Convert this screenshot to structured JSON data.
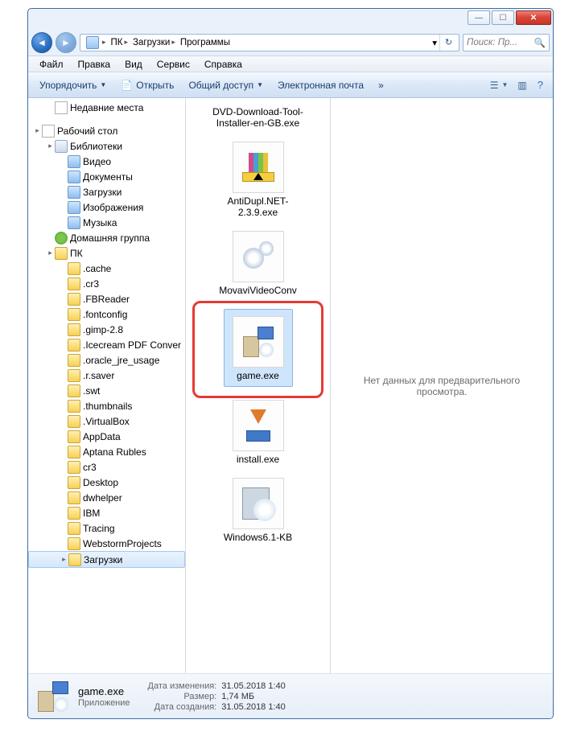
{
  "window": {
    "minimize": "—",
    "maximize": "☐",
    "close": "✕"
  },
  "breadcrumb": {
    "items": [
      "ПК",
      "Загрузки",
      "Программы"
    ]
  },
  "search": {
    "placeholder": "Поиск: Пр..."
  },
  "menubar": [
    "Файл",
    "Правка",
    "Вид",
    "Сервис",
    "Справка"
  ],
  "toolbar": {
    "organize": "Упорядочить",
    "open": "Открыть",
    "share": "Общий доступ",
    "email": "Электронная почта",
    "more": "»"
  },
  "tree": [
    {
      "indent": 1,
      "twisty": "",
      "iconClass": "ic-recent",
      "label": "Недавние места"
    },
    {
      "spacer": true
    },
    {
      "indent": 0,
      "twisty": "▸",
      "iconClass": "ic-desk",
      "label": "Рабочий стол"
    },
    {
      "indent": 1,
      "twisty": "▸",
      "iconClass": "ic-lib",
      "label": "Библиотеки"
    },
    {
      "indent": 2,
      "twisty": "",
      "iconClass": "ic-special",
      "label": "Видео"
    },
    {
      "indent": 2,
      "twisty": "",
      "iconClass": "ic-special",
      "label": "Документы"
    },
    {
      "indent": 2,
      "twisty": "",
      "iconClass": "ic-special",
      "label": "Загрузки"
    },
    {
      "indent": 2,
      "twisty": "",
      "iconClass": "ic-special",
      "label": "Изображения"
    },
    {
      "indent": 2,
      "twisty": "",
      "iconClass": "ic-special",
      "label": "Музыка"
    },
    {
      "indent": 1,
      "twisty": "",
      "iconClass": "ic-hg",
      "label": "Домашняя группа"
    },
    {
      "indent": 1,
      "twisty": "▸",
      "iconClass": "ic-folder",
      "label": "ПК"
    },
    {
      "indent": 2,
      "twisty": "",
      "iconClass": "ic-folder",
      "label": ".cache"
    },
    {
      "indent": 2,
      "twisty": "",
      "iconClass": "ic-folder",
      "label": ".cr3"
    },
    {
      "indent": 2,
      "twisty": "",
      "iconClass": "ic-folder",
      "label": ".FBReader"
    },
    {
      "indent": 2,
      "twisty": "",
      "iconClass": "ic-folder",
      "label": ".fontconfig"
    },
    {
      "indent": 2,
      "twisty": "",
      "iconClass": "ic-folder",
      "label": ".gimp-2.8"
    },
    {
      "indent": 2,
      "twisty": "",
      "iconClass": "ic-folder",
      "label": ".Icecream PDF Conver"
    },
    {
      "indent": 2,
      "twisty": "",
      "iconClass": "ic-folder",
      "label": ".oracle_jre_usage"
    },
    {
      "indent": 2,
      "twisty": "",
      "iconClass": "ic-folder",
      "label": ".r.saver"
    },
    {
      "indent": 2,
      "twisty": "",
      "iconClass": "ic-folder",
      "label": ".swt"
    },
    {
      "indent": 2,
      "twisty": "",
      "iconClass": "ic-folder",
      "label": ".thumbnails"
    },
    {
      "indent": 2,
      "twisty": "",
      "iconClass": "ic-folder",
      "label": ".VirtualBox"
    },
    {
      "indent": 2,
      "twisty": "",
      "iconClass": "ic-folder",
      "label": "AppData"
    },
    {
      "indent": 2,
      "twisty": "",
      "iconClass": "ic-folder",
      "label": "Aptana Rubles"
    },
    {
      "indent": 2,
      "twisty": "",
      "iconClass": "ic-folder",
      "label": "cr3"
    },
    {
      "indent": 2,
      "twisty": "",
      "iconClass": "ic-folder",
      "label": "Desktop"
    },
    {
      "indent": 2,
      "twisty": "",
      "iconClass": "ic-folder",
      "label": "dwhelper"
    },
    {
      "indent": 2,
      "twisty": "",
      "iconClass": "ic-folder",
      "label": "IBM"
    },
    {
      "indent": 2,
      "twisty": "",
      "iconClass": "ic-folder",
      "label": "Tracing"
    },
    {
      "indent": 2,
      "twisty": "",
      "iconClass": "ic-folder",
      "label": "WebstormProjects"
    },
    {
      "indent": 2,
      "twisty": "▸",
      "iconClass": "ic-folder",
      "label": "Загрузки",
      "selected": true
    }
  ],
  "files": [
    {
      "label": "DVD-Download-Tool-Installer-en-GB.exe",
      "icon": "none"
    },
    {
      "label": "AntiDupl.NET-2.3.9.exe",
      "icon": "winrar"
    },
    {
      "label": "MovaviVideoConv",
      "icon": "gears"
    },
    {
      "label": "game.exe",
      "icon": "installer",
      "selected": true,
      "ring": true
    },
    {
      "label": "install.exe",
      "icon": "dlarrow"
    },
    {
      "label": "Windоws6.1-KB",
      "icon": "cdcase"
    }
  ],
  "preview": {
    "text": "Нет данных для предварительного просмотра."
  },
  "details": {
    "name": "game.exe",
    "type": "Приложение",
    "props": [
      {
        "k": "Дата изменения:",
        "v": "31.05.2018 1:40"
      },
      {
        "k": "Размер:",
        "v": "1,74 МБ"
      },
      {
        "k": "Дата создания:",
        "v": "31.05.2018 1:40"
      }
    ]
  }
}
